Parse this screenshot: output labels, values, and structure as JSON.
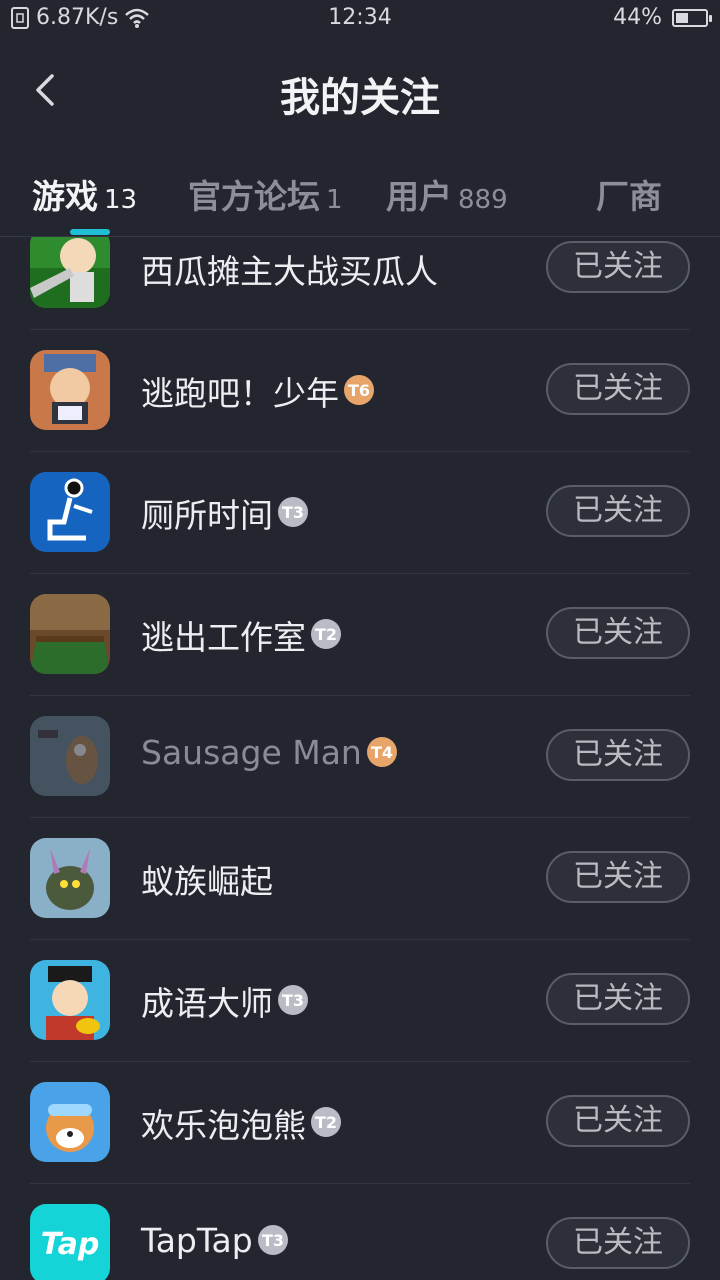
{
  "status": {
    "speed": "6.87K/s",
    "time": "12:34",
    "battery": "44%",
    "battery_level": 0.44
  },
  "header": {
    "title": "我的关注"
  },
  "tabs": [
    {
      "label": "游戏",
      "count": "13"
    },
    {
      "label": "官方论坛",
      "count": "1"
    },
    {
      "label": "用户",
      "count": "889"
    },
    {
      "label": "厂商",
      "count": ""
    }
  ],
  "follow_label": "已关注",
  "games": [
    {
      "name": "西瓜摊主大战买瓜人",
      "badge": ""
    },
    {
      "name": "逃跑吧！少年",
      "badge": "T6",
      "badge_color": "#e8a56a"
    },
    {
      "name": "厕所时间",
      "badge": "T3",
      "badge_color": "#b9bcc4"
    },
    {
      "name": "逃出工作室",
      "badge": "T2",
      "badge_color": "#b9bcc4"
    },
    {
      "name": "Sausage Man",
      "badge": "T4",
      "badge_color": "#e8a56a"
    },
    {
      "name": "蚁族崛起",
      "badge": ""
    },
    {
      "name": "成语大师",
      "badge": "T3",
      "badge_color": "#b9bcc4"
    },
    {
      "name": "欢乐泡泡熊",
      "badge": "T2",
      "badge_color": "#b9bcc4"
    },
    {
      "name": "TapTap",
      "badge": "T3",
      "badge_color": "#b9bcc4"
    }
  ],
  "icon_names": [
    "watermelon-game-icon",
    "escape-boy-icon",
    "toilet-time-icon",
    "escape-studio-icon",
    "sausage-man-icon",
    "ant-rise-icon",
    "idiom-master-icon",
    "bubble-bear-icon",
    "taptap-icon"
  ],
  "taptap_logo_text": "Tap"
}
